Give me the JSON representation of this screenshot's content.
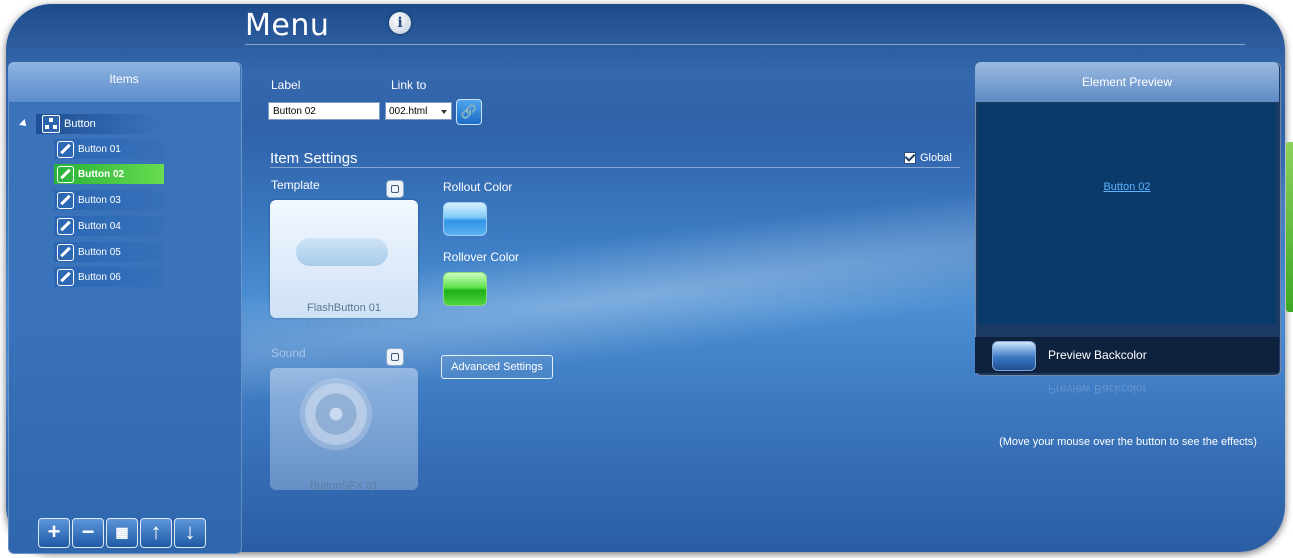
{
  "header": {
    "title": "Menu",
    "info_icon": "info-icon"
  },
  "items_panel": {
    "title": "Items",
    "root_label": "Button",
    "items": [
      {
        "label": "Button 01",
        "selected": false
      },
      {
        "label": "Button 02",
        "selected": true
      },
      {
        "label": "Button 03",
        "selected": false
      },
      {
        "label": "Button 04",
        "selected": false
      },
      {
        "label": "Button 05",
        "selected": false
      },
      {
        "label": "Button 06",
        "selected": false
      }
    ],
    "toolbar": {
      "add": "+",
      "remove": "−",
      "tree": "tree-icon",
      "up": "↑",
      "down": "↓"
    }
  },
  "form": {
    "label_caption": "Label",
    "link_caption": "Link to",
    "label_value": "Button 02",
    "link_value": "002.html",
    "item_settings_title": "Item Settings",
    "global_label": "Global",
    "template_caption": "Template",
    "template_name": "FlashButton 01",
    "rollout_caption": "Rollout Color",
    "rollover_caption": "Rollover Color",
    "sound_caption": "Sound",
    "sound_name": "ButtonSFX 01",
    "advanced_label": "Advanced Settings"
  },
  "preview": {
    "title": "Element Preview",
    "link_text": "Button 02",
    "backcolor_label": "Preview Backcolor",
    "hint": "(Move your mouse over the button to see the effects)"
  },
  "colors": {
    "rollout": "#4aa9f0",
    "rollover": "#2fc423",
    "preview_bg": "#0a3a6a"
  }
}
